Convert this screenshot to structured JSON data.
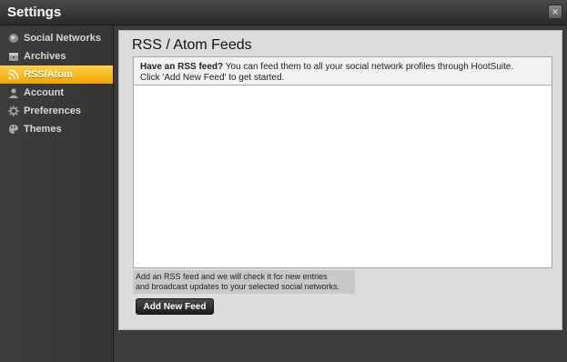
{
  "window": {
    "title": "Settings",
    "close_label": "×"
  },
  "sidebar": {
    "items": [
      {
        "label": "Social Networks",
        "icon": "globe-icon",
        "active": false
      },
      {
        "label": "Archives",
        "icon": "archive-box-icon",
        "active": false
      },
      {
        "label": "RSS/Atom",
        "icon": "rss-icon",
        "active": true
      },
      {
        "label": "Account",
        "icon": "user-icon",
        "active": false
      },
      {
        "label": "Preferences",
        "icon": "gear-icon",
        "active": false
      },
      {
        "label": "Themes",
        "icon": "palette-icon",
        "active": false
      }
    ]
  },
  "main": {
    "title": "RSS / Atom Feeds",
    "intro_bold": "Have an RSS feed?",
    "intro_text": " You can feed them to all your social network profiles through HootSuite.",
    "intro_line2": "Click 'Add New Feed' to get started.",
    "info_line1": "Add an RSS feed and we will check it for new entries",
    "info_line2": "and broadcast updates to your selected social networks.",
    "add_button": "Add New Feed"
  },
  "colors": {
    "active_accent": "#f5b80f",
    "sidebar_bg": "#3a3a3a",
    "panel_bg": "#dcdcdc"
  }
}
